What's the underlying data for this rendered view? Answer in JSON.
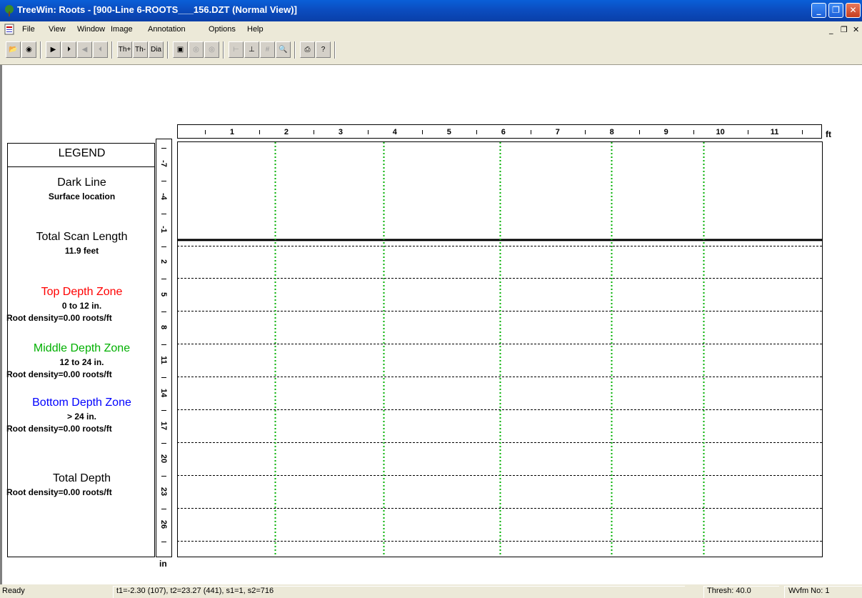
{
  "window": {
    "title": "TreeWin: Roots - [900-Line 6-ROOTS___156.DZT (Normal View)]",
    "controls": {
      "minimize": "_",
      "maximize": "❐",
      "close": "✕"
    },
    "mdi_controls": {
      "minimize": "_",
      "restore": "❐",
      "close": "✕"
    }
  },
  "menu": [
    "File",
    "View",
    "Window",
    "Image",
    "Annotation",
    "Options",
    "Help"
  ],
  "toolbar": {
    "th_plus": "Th+",
    "th_minus": "Th-",
    "dia": "Dia"
  },
  "legend": {
    "heading": "LEGEND",
    "dark_line_title": "Dark Line",
    "dark_line_desc": "Surface location",
    "scan_length_title": "Total Scan Length",
    "scan_length_value": "11.9 feet",
    "top_zone": {
      "title": "Top Depth Zone",
      "range": "0 to 12 in.",
      "density": "Root density=0.00 roots/ft",
      "color": "#ff0000"
    },
    "middle_zone": {
      "title": "Middle Depth Zone",
      "range": "12 to 24 in.",
      "density": "Root density=0.00 roots/ft",
      "color": "#00b000"
    },
    "bottom_zone": {
      "title": "Bottom Depth Zone",
      "range": "> 24 in.",
      "density": "Root density=0.00 roots/ft",
      "color": "#0000ff"
    },
    "total_depth_title": "Total Depth",
    "total_depth_density": "Root density=0.00 roots/ft"
  },
  "chart_data": {
    "type": "scatter",
    "title": "",
    "xlabel": "ft",
    "ylabel": "in",
    "xlim": [
      0,
      11.9
    ],
    "ylim": [
      -9,
      29
    ],
    "x_ticks": [
      "1",
      "2",
      "3",
      "4",
      "5",
      "6",
      "7",
      "8",
      "9",
      "10",
      "11"
    ],
    "y_ticks": [
      "-7",
      "-4",
      "-1",
      "2",
      "5",
      "8",
      "11",
      "14",
      "17",
      "20",
      "23",
      "26"
    ],
    "surface_depth": 0,
    "marker_positions_ft": [
      1.8,
      3.8,
      5.95,
      8.0,
      9.7
    ],
    "marker_color": "#00b000",
    "series": []
  },
  "status": {
    "ready": "Ready",
    "readout": "t1=-2.30 (107), t2=23.27 (441), s1=1, s2=716",
    "thresh": "Thresh: 40.0",
    "wvfm": "Wvfm No: 1"
  }
}
